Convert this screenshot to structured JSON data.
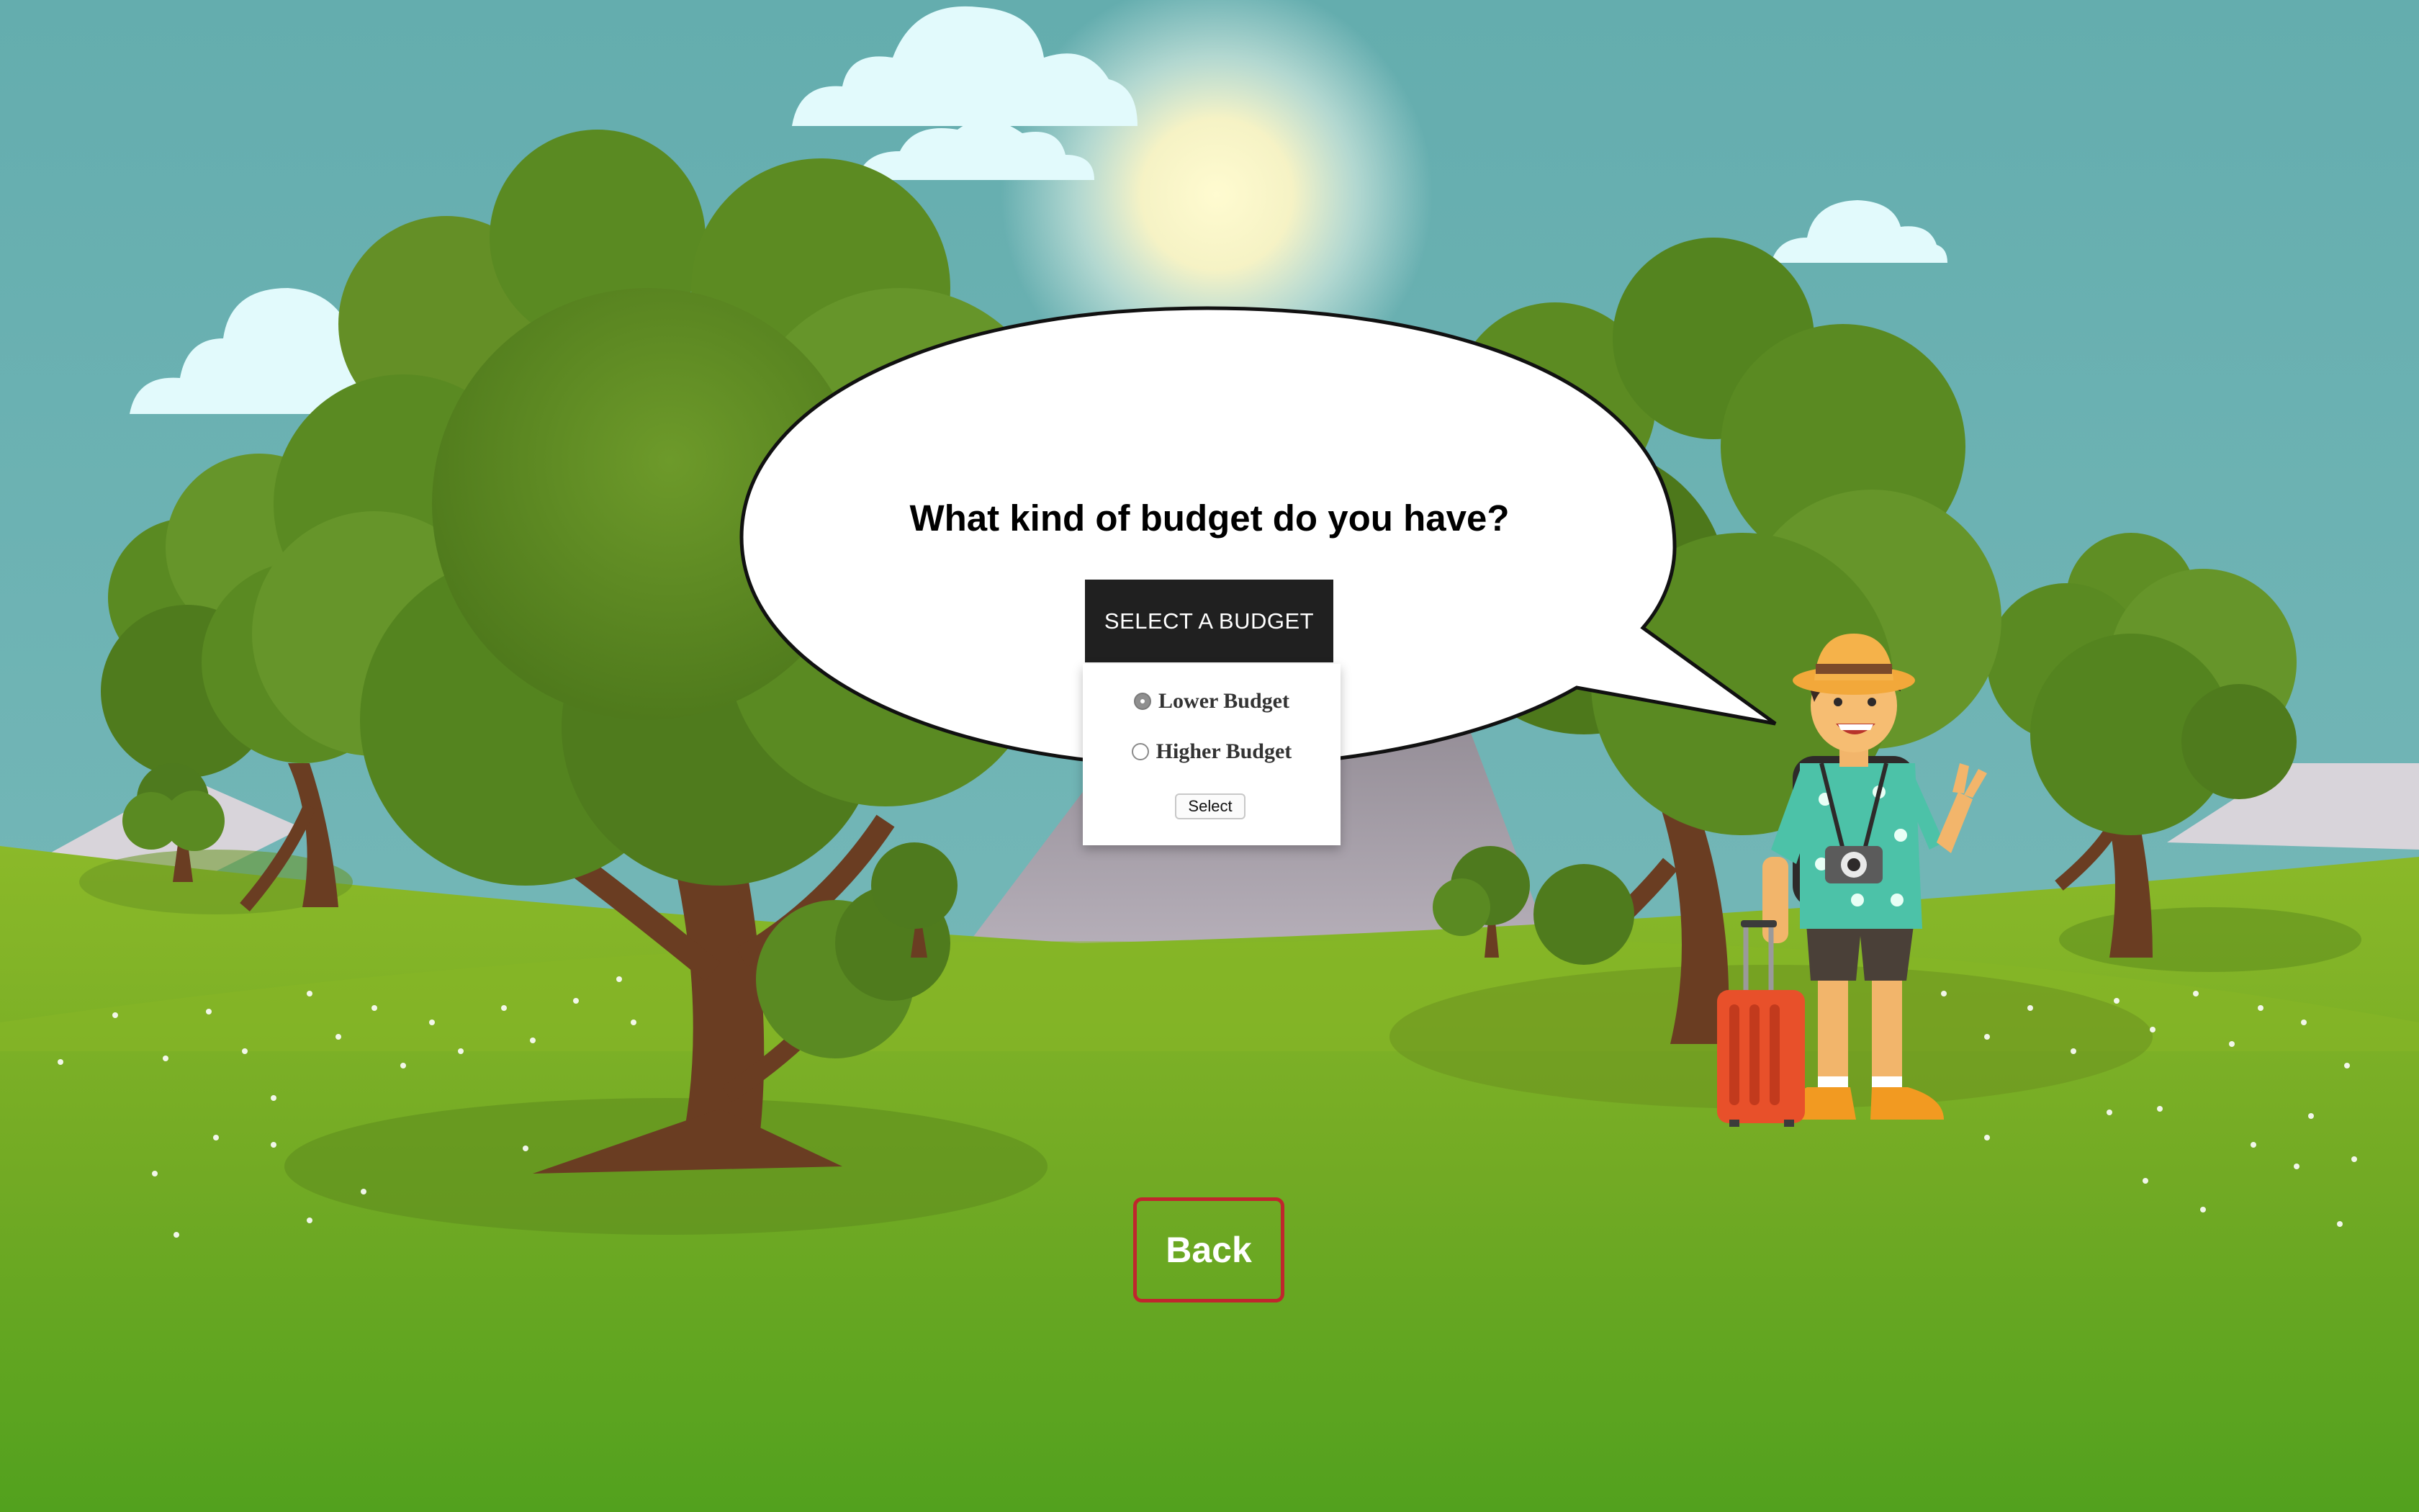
{
  "prompt": {
    "question": "What kind of budget do you have?"
  },
  "budget_dropdown": {
    "label": "SELECT A BUDGET",
    "options": [
      {
        "label": "Lower Budget",
        "selected": true
      },
      {
        "label": "Higher Budget",
        "selected": false
      }
    ],
    "submit_label": "Select"
  },
  "navigation": {
    "back_label": "Back"
  },
  "scene": {
    "icons": [
      "sun-icon",
      "cloud-icon",
      "tree-icon",
      "mountain-icon",
      "traveler-illustration",
      "suitcase-icon",
      "camera-icon"
    ],
    "colors": {
      "sky": "#66aeae",
      "grass_light": "#8cb828",
      "grass_dark": "#55a21f",
      "tree_foliage": "#5e8a22",
      "trunk": "#6a3d22",
      "bubble": "#ffffff",
      "dropdown_bg": "#202020",
      "back_border": "#c0262d",
      "suitcase": "#e8502a"
    }
  }
}
